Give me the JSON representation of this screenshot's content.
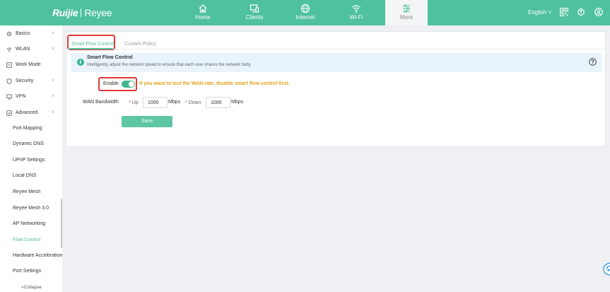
{
  "brand": {
    "logo": "Ruijie",
    "product": "Reyee"
  },
  "top_nav": [
    {
      "label": "Home",
      "icon": "home-icon"
    },
    {
      "label": "Clients",
      "icon": "clients-icon"
    },
    {
      "label": "Internet",
      "icon": "globe-icon"
    },
    {
      "label": "Wi-Fi",
      "icon": "wifi-icon"
    },
    {
      "label": "More",
      "icon": "sliders-icon",
      "active": true
    }
  ],
  "header_right": {
    "language": "English",
    "icons": [
      "qr-code-icon",
      "upgrade-icon",
      "account-icon"
    ]
  },
  "sidebar": {
    "items": [
      {
        "label": "Basics",
        "icon": "gear-icon",
        "chevron": "˅"
      },
      {
        "label": "WLAN",
        "icon": "wifi-icon",
        "chevron": "˅"
      },
      {
        "label": "Work Mode",
        "icon": "mode-icon"
      },
      {
        "label": "Security",
        "icon": "shield-icon",
        "chevron": "˅"
      },
      {
        "label": "VPN",
        "icon": "vpn-icon",
        "chevron": "˅"
      },
      {
        "label": "Advanced",
        "icon": "advanced-icon",
        "chevron": "˄"
      }
    ],
    "subitems": [
      {
        "label": "Port Mapping"
      },
      {
        "label": "Dynamic DNS"
      },
      {
        "label": "UPnP Settings"
      },
      {
        "label": "Local DNS"
      },
      {
        "label": "Reyee Mesh"
      },
      {
        "label": "Reyee Mesh 3.0"
      },
      {
        "label": "AP Networking"
      },
      {
        "label": "Flow Control",
        "active": true
      },
      {
        "label": "Hardware Acceleration"
      },
      {
        "label": "Port Settings"
      }
    ],
    "collapse_label": "«Collapse"
  },
  "tabs": [
    {
      "label": "Smart Flow Control",
      "active": true
    },
    {
      "label": "Custom Policy"
    }
  ],
  "banner": {
    "title": "Smart Flow Control",
    "description": "Intelligently adjust the network speed to ensure that each user shares the network fairly."
  },
  "form": {
    "enable_label": "Enable",
    "enable_on": true,
    "warning": "If you want to test the WAN rate, disable smart flow control first.",
    "wan_label": "WAN Bandwidth",
    "up_label": "Up",
    "up_value": "1000",
    "down_label": "Down",
    "down_value": "1000",
    "unit": "Mbps",
    "required_mark": "*"
  },
  "save_label": "Save",
  "colors": {
    "brand": "#4fc19e",
    "warning": "#e0a21b",
    "highlight": "#e03a3a"
  }
}
